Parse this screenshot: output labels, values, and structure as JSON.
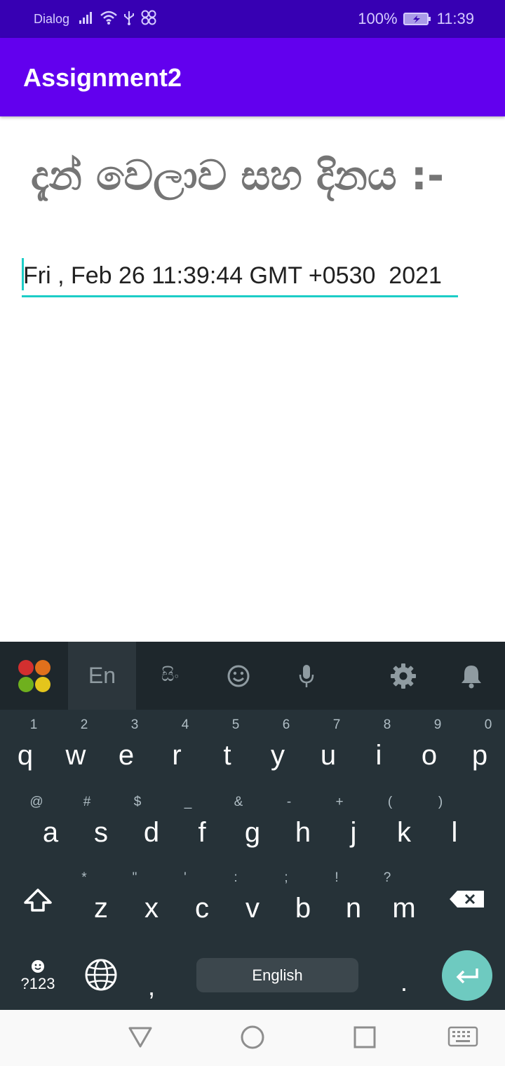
{
  "status_bar": {
    "carrier": "Dialog",
    "battery_percent": "100%",
    "time": "11:39",
    "icons": [
      "signal-icon",
      "wifi-icon",
      "usb-icon",
      "pattern-icon",
      "battery-charging-icon"
    ]
  },
  "app_bar": {
    "title": "Assignment2"
  },
  "content": {
    "heading": "දැන් වෙලාව සහ දිනය :-",
    "date_value": "Fri , Feb 26 11:39:44 GMT +0530  2021"
  },
  "keyboard": {
    "toolbar": {
      "items": [
        "app-logo-icon",
        "En",
        "සිං",
        "emoji-icon",
        "microphone-icon",
        "settings-icon",
        "notification-bell-icon"
      ],
      "active_language": "En",
      "sinhala_label": "සිං"
    },
    "row1": [
      {
        "key": "q",
        "hint": "1"
      },
      {
        "key": "w",
        "hint": "2"
      },
      {
        "key": "e",
        "hint": "3"
      },
      {
        "key": "r",
        "hint": "4"
      },
      {
        "key": "t",
        "hint": "5"
      },
      {
        "key": "y",
        "hint": "6"
      },
      {
        "key": "u",
        "hint": "7"
      },
      {
        "key": "i",
        "hint": "8"
      },
      {
        "key": "o",
        "hint": "9"
      },
      {
        "key": "p",
        "hint": "0"
      }
    ],
    "row2": [
      {
        "key": "a",
        "hint": "@"
      },
      {
        "key": "s",
        "hint": "#"
      },
      {
        "key": "d",
        "hint": "$"
      },
      {
        "key": "f",
        "hint": "_"
      },
      {
        "key": "g",
        "hint": "&"
      },
      {
        "key": "h",
        "hint": "-"
      },
      {
        "key": "j",
        "hint": "+"
      },
      {
        "key": "k",
        "hint": "("
      },
      {
        "key": "l",
        "hint": ")"
      }
    ],
    "row3": [
      {
        "key": "z",
        "hint": "*"
      },
      {
        "key": "x",
        "hint": "\""
      },
      {
        "key": "c",
        "hint": "'"
      },
      {
        "key": "v",
        "hint": ":"
      },
      {
        "key": "b",
        "hint": ";"
      },
      {
        "key": "n",
        "hint": "!"
      },
      {
        "key": "m",
        "hint": "?"
      }
    ],
    "bottom_row": {
      "symbols_label": "?123",
      "comma": ",",
      "space_label": "English",
      "period": "."
    }
  },
  "nav_bar": {
    "items": [
      "back-icon",
      "home-icon",
      "recents-icon",
      "keyboard-toggle-icon"
    ]
  },
  "colors": {
    "status_bar": "#3700b3",
    "app_bar": "#6200ee",
    "accent": "#1ccdc7",
    "keyboard_bg": "#263238",
    "enter_key": "#6ecac0"
  }
}
